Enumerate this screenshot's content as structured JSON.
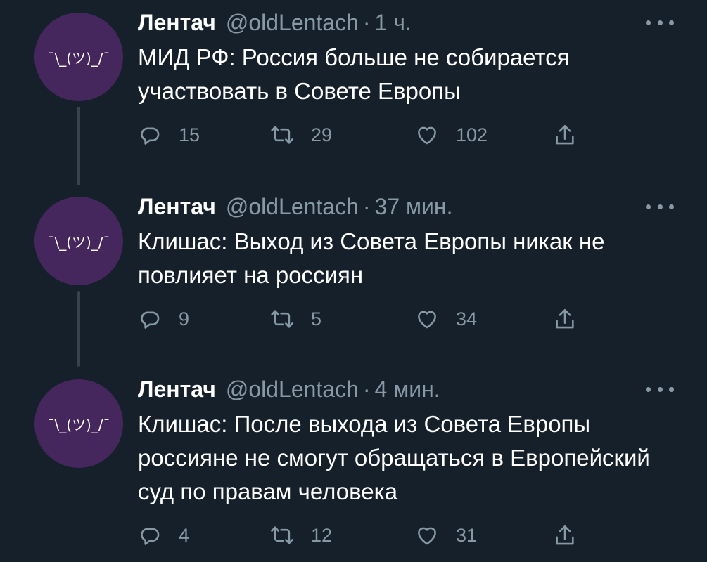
{
  "tweets": [
    {
      "avatar_text": "¯\\_(ツ)_/¯",
      "name": "Лентач",
      "handle": "@oldLentach",
      "time": "1 ч.",
      "text": "МИД РФ: Россия больше не собирается участвовать в Совете Европы",
      "replies": "15",
      "retweets": "29",
      "likes": "102"
    },
    {
      "avatar_text": "¯\\_(ツ)_/¯",
      "name": "Лентач",
      "handle": "@oldLentach",
      "time": "37 мин.",
      "text": "Клишас: Выход из Совета Европы никак не повлияет на россиян",
      "replies": "9",
      "retweets": "5",
      "likes": "34"
    },
    {
      "avatar_text": "¯\\_(ツ)_/¯",
      "name": "Лентач",
      "handle": "@oldLentach",
      "time": "4 мин.",
      "text": "Клишас: После выхода из Совета Европы россияне не смогут обращаться в Европейский суд по правам человека",
      "replies": "4",
      "retweets": "12",
      "likes": "31"
    }
  ],
  "dot_separator": "·",
  "colors": {
    "background": "#15202b",
    "muted": "#8899a6",
    "avatar": "#45275e",
    "thread_line": "#38444d"
  }
}
